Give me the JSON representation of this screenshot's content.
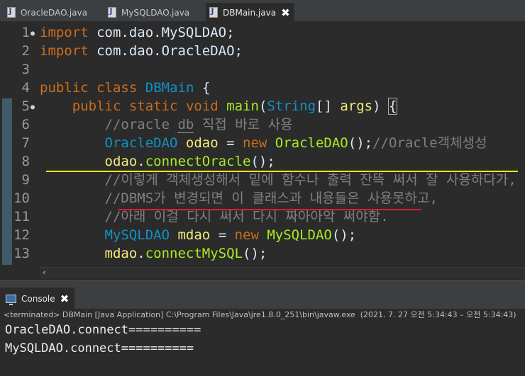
{
  "tabs": [
    {
      "label": "OracleDAO.java",
      "active": false
    },
    {
      "label": "MySQLDAO.java",
      "active": false
    },
    {
      "label": "DBMain.java",
      "active": true
    }
  ],
  "tab_close_glyph": "✖",
  "editor": {
    "lines": [
      {
        "n": "1",
        "fold": "●",
        "tokens": [
          [
            "kw",
            "import"
          ],
          [
            "pl",
            " com.dao.MySQLDAO;"
          ]
        ]
      },
      {
        "n": "2",
        "fold": "",
        "tokens": [
          [
            "kw",
            "import"
          ],
          [
            "pl",
            " com.dao.OracleDAO;"
          ]
        ]
      },
      {
        "n": "3",
        "fold": "",
        "tokens": []
      },
      {
        "n": "4",
        "fold": "",
        "tokens": [
          [
            "kw",
            "public"
          ],
          [
            "pl",
            " "
          ],
          [
            "kw",
            "class"
          ],
          [
            "pl",
            " "
          ],
          [
            "cls",
            "DBMain"
          ],
          [
            "pl",
            " {"
          ]
        ]
      },
      {
        "n": "5",
        "fold": "●",
        "tokens": [
          [
            "pl",
            "    "
          ],
          [
            "kw",
            "public"
          ],
          [
            "pl",
            " "
          ],
          [
            "kw",
            "static"
          ],
          [
            "pl",
            " "
          ],
          [
            "kw",
            "void"
          ],
          [
            "pl",
            " "
          ],
          [
            "fn",
            "main"
          ],
          [
            "pl",
            "("
          ],
          [
            "cls",
            "String"
          ],
          [
            "pl",
            "[] "
          ],
          [
            "var",
            "args"
          ],
          [
            "pl",
            ") "
          ],
          [
            "brk",
            "{"
          ]
        ]
      },
      {
        "n": "6",
        "fold": "",
        "tokens": [
          [
            "pl",
            "        "
          ],
          [
            "cm",
            "//oracle "
          ],
          [
            "cmu",
            "db"
          ],
          [
            "cm",
            " 직접 바로 사용"
          ]
        ]
      },
      {
        "n": "7",
        "fold": "",
        "tokens": [
          [
            "pl",
            "        "
          ],
          [
            "cls",
            "OracleDAO"
          ],
          [
            "pl",
            " "
          ],
          [
            "var",
            "odao"
          ],
          [
            "pl",
            " = "
          ],
          [
            "kw",
            "new"
          ],
          [
            "pl",
            " "
          ],
          [
            "fn",
            "OracleDAO"
          ],
          [
            "pl",
            "();"
          ],
          [
            "cm",
            "//Oracle객체생성"
          ]
        ]
      },
      {
        "n": "8",
        "fold": "",
        "tokens": [
          [
            "pl",
            "        "
          ],
          [
            "var",
            "odao"
          ],
          [
            "pl",
            "."
          ],
          [
            "fn",
            "connectOracle"
          ],
          [
            "pl",
            "();"
          ]
        ]
      },
      {
        "n": "9",
        "fold": "",
        "tokens": [
          [
            "pl",
            "        "
          ],
          [
            "cm",
            "//이렇게 객체생성해서 밑에 함수나 출력 잔뜩 써서 잘 사용하다가,"
          ]
        ]
      },
      {
        "n": "10",
        "fold": "",
        "tokens": [
          [
            "pl",
            "        "
          ],
          [
            "cm",
            "//DBMS가 변경되면 이 클래스과 내용들은 사용못하고,"
          ]
        ]
      },
      {
        "n": "11",
        "fold": "",
        "tokens": [
          [
            "pl",
            "        "
          ],
          [
            "cm",
            "//아래 이걸 다시 써서 다시 짜아아악 써야함."
          ]
        ]
      },
      {
        "n": "12",
        "fold": "",
        "tokens": [
          [
            "pl",
            "        "
          ],
          [
            "cls",
            "MySQLDAO"
          ],
          [
            "pl",
            " "
          ],
          [
            "var",
            "mdao"
          ],
          [
            "pl",
            " = "
          ],
          [
            "kw",
            "new"
          ],
          [
            "pl",
            " "
          ],
          [
            "fn",
            "MySQLDAO"
          ],
          [
            "pl",
            "();"
          ]
        ]
      },
      {
        "n": "13",
        "fold": "",
        "tokens": [
          [
            "pl",
            "        "
          ],
          [
            "var",
            "mdao"
          ],
          [
            "pl",
            "."
          ],
          [
            "fn",
            "connectMySQL"
          ],
          [
            "pl",
            "();"
          ]
        ]
      }
    ],
    "scroll_arrow": "‹"
  },
  "console": {
    "tab_label": "Console",
    "status": "<terminated> DBMain [Java Application] C:\\Program Files\\Java\\jre1.8.0_251\\bin\\javaw.exe  (2021. 7. 27 오전 5:34:43 – 오전 5:34:43)",
    "output": [
      "OracleDAO.connect==========",
      "MySQLDAO.connect=========="
    ]
  },
  "colors": {
    "keyword": "#cc6c1d",
    "class": "#1290c3",
    "method": "#a7ec21",
    "variable": "#f3ec79",
    "comment": "#808080",
    "yellow_annotation": "#ffe815",
    "red_annotation": "#e0183c"
  }
}
